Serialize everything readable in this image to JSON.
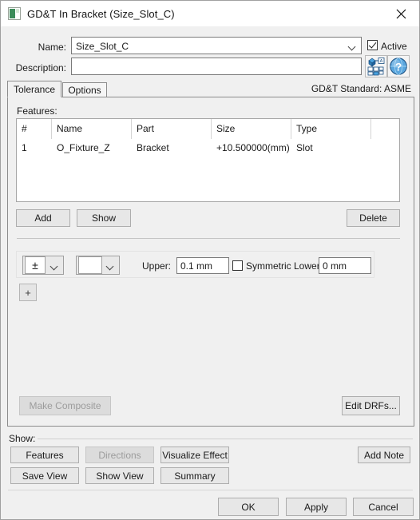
{
  "window": {
    "title": "GD&T In Bracket (Size_Slot_C)",
    "icon": "gdt-window-icon",
    "close_label": "✕"
  },
  "form": {
    "name_label": "Name:",
    "name_value": "Size_Slot_C",
    "description_label": "Description:",
    "description_value": "",
    "description_placeholder": "",
    "active_label": "Active",
    "active_checked": true,
    "icons": [
      {
        "name": "feature-picker-icon"
      },
      {
        "name": "help-icon"
      }
    ]
  },
  "tabs": {
    "items": [
      {
        "label": "Tolerance",
        "active": true
      },
      {
        "label": "Options",
        "active": false
      }
    ],
    "standard_text": "GD&T Standard: ASME"
  },
  "features": {
    "label": "Features:",
    "columns": [
      "#",
      "Name",
      "Part",
      "Size",
      "Type"
    ],
    "rows": [
      {
        "num": "1",
        "name": "O_Fixture_Z",
        "part": "Bracket",
        "size": "+10.500000(mm)",
        "type": "Slot"
      }
    ],
    "buttons": {
      "add": "Add",
      "show": "Show",
      "delete": "Delete"
    }
  },
  "tolerance_row": {
    "symbol": "±",
    "symbol_name": "plus-minus-symbol",
    "modifier": "",
    "upper_label": "Upper:",
    "upper_value": "0.1 mm",
    "symmetric_label": "Symmetric Lower:",
    "symmetric_checked": false,
    "lower_value": "0 mm",
    "add_row_label": "+"
  },
  "tolerance_footer": {
    "make_composite": "Make Composite",
    "make_composite_disabled": true,
    "edit_drfs": "Edit DRFs..."
  },
  "show_group": {
    "caption": "Show:",
    "buttons": [
      {
        "label": "Features",
        "disabled": false
      },
      {
        "label": "Directions",
        "disabled": true
      },
      {
        "label": "Visualize Effect",
        "disabled": false
      },
      {
        "label": "Add Note",
        "disabled": false
      },
      {
        "label": "Save View",
        "disabled": false
      },
      {
        "label": "Show View",
        "disabled": false
      },
      {
        "label": "Summary",
        "disabled": false
      }
    ]
  },
  "dialog_buttons": {
    "ok": "OK",
    "apply": "Apply",
    "cancel": "Cancel"
  },
  "colors": {
    "window_bg": "#f0f0f0",
    "titlebar_bg": "#ffffff",
    "field_bg": "#ffffff",
    "button_bg": "#e7e7e7",
    "border": "#8c8c8c",
    "disabled_text": "#9c9c9c",
    "icon_blue": "#3a7ec8"
  }
}
